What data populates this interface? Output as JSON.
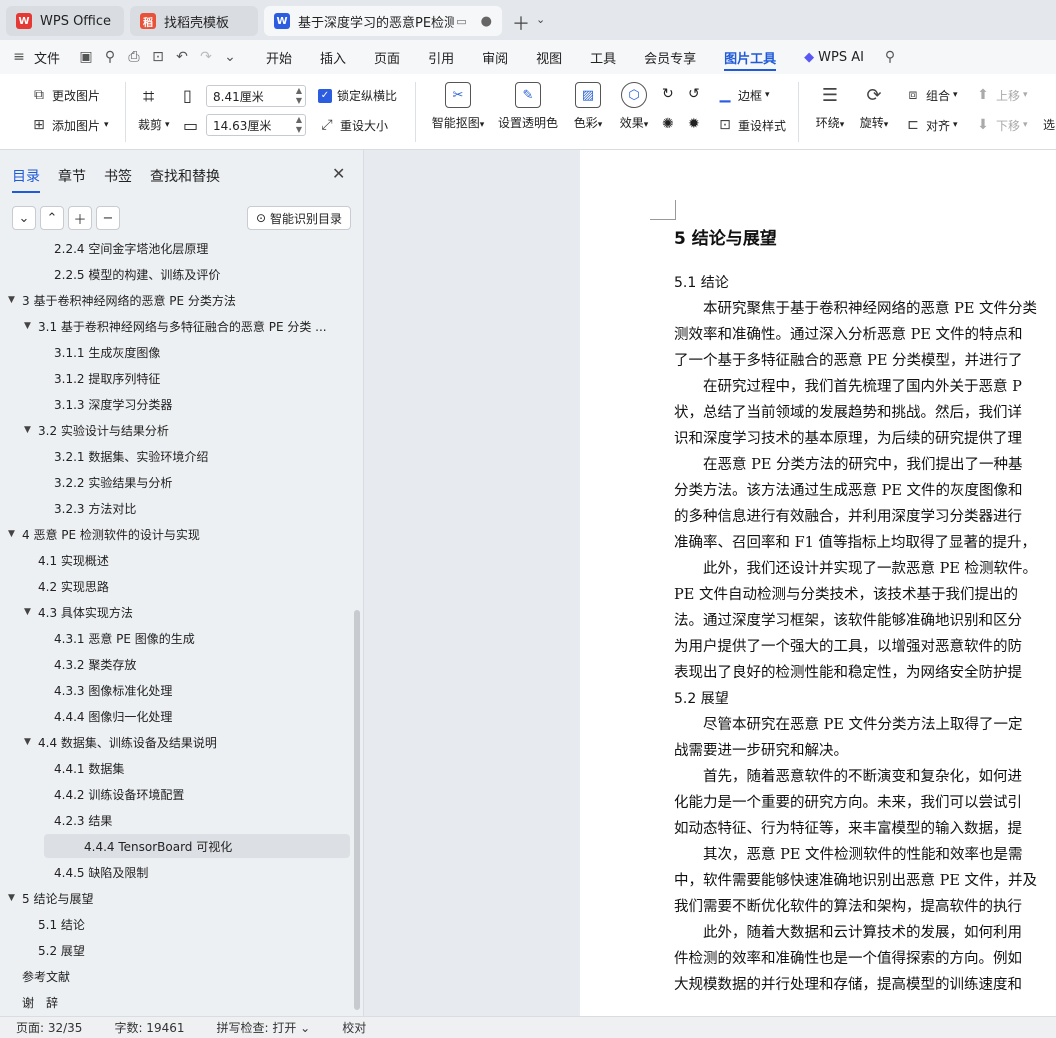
{
  "tabs": [
    {
      "label": "WPS Office",
      "logo": "W"
    },
    {
      "label": "找稻壳模板",
      "logo": "稻"
    },
    {
      "label": "基于深度学习的恶意PE检测软",
      "logo": "W",
      "active": true
    }
  ],
  "menu": {
    "file": "文件",
    "items": [
      "开始",
      "插入",
      "页面",
      "引用",
      "审阅",
      "视图",
      "工具",
      "会员专享"
    ],
    "active": "图片工具",
    "ai": "WPS AI"
  },
  "ribbon": {
    "change_pic": "更改图片",
    "add_pic": "添加图片",
    "crop": "裁剪",
    "width": "8.41厘米",
    "height": "14.63厘米",
    "lock_ratio": "锁定纵横比",
    "resize": "重设大小",
    "smart_cutout": "智能抠图",
    "set_transparent": "设置透明色",
    "color": "色彩",
    "effect": "效果",
    "border": "边框",
    "reset_style": "重设样式",
    "wrap": "环绕",
    "rotate": "旋转",
    "group": "组合",
    "align": "对齐",
    "up": "上移",
    "down": "下移",
    "select": "选"
  },
  "panel": {
    "tabs": [
      "目录",
      "章节",
      "书签",
      "查找和替换"
    ],
    "smart_toc": "智能识别目录",
    "toc": [
      {
        "text": "2.2.4 空间金字塔池化层原理",
        "level": 3,
        "exp": ""
      },
      {
        "text": "2.2.5 模型的构建、训练及评价",
        "level": 3,
        "exp": ""
      },
      {
        "text": "3 基于卷积神经网络的恶意 PE 分类方法",
        "level": 1,
        "exp": "▼"
      },
      {
        "text": "3.1 基于卷积神经网络与多特征融合的恶意 PE 分类 ...",
        "level": 2,
        "exp": "▼"
      },
      {
        "text": "3.1.1 生成灰度图像",
        "level": 3,
        "exp": ""
      },
      {
        "text": "3.1.2 提取序列特征",
        "level": 3,
        "exp": ""
      },
      {
        "text": "3.1.3 深度学习分类器",
        "level": 3,
        "exp": ""
      },
      {
        "text": "3.2 实验设计与结果分析",
        "level": 2,
        "exp": "▼"
      },
      {
        "text": "3.2.1 数据集、实验环境介绍",
        "level": 3,
        "exp": ""
      },
      {
        "text": "3.2.2 实验结果与分析",
        "level": 3,
        "exp": ""
      },
      {
        "text": "3.2.3 方法对比",
        "level": 3,
        "exp": ""
      },
      {
        "text": "4 恶意 PE 检测软件的设计与实现",
        "level": 1,
        "exp": "▼"
      },
      {
        "text": "4.1 实现概述",
        "level": 2,
        "exp": ""
      },
      {
        "text": "4.2 实现思路",
        "level": 2,
        "exp": ""
      },
      {
        "text": "4.3 具体实现方法",
        "level": 2,
        "exp": "▼"
      },
      {
        "text": "4.3.1 恶意 PE 图像的生成",
        "level": 3,
        "exp": ""
      },
      {
        "text": "4.3.2 聚类存放",
        "level": 3,
        "exp": ""
      },
      {
        "text": "4.3.3 图像标准化处理",
        "level": 3,
        "exp": ""
      },
      {
        "text": "4.4.4 图像归一化处理",
        "level": 3,
        "exp": ""
      },
      {
        "text": "4.4 数据集、训练设备及结果说明",
        "level": 2,
        "exp": "▼"
      },
      {
        "text": "4.4.1 数据集",
        "level": 3,
        "exp": ""
      },
      {
        "text": "4.4.2 训练设备环境配置",
        "level": 3,
        "exp": ""
      },
      {
        "text": "4.2.3 结果",
        "level": 3,
        "exp": ""
      },
      {
        "text": "4.4.4 TensorBoard 可视化",
        "level": 3,
        "exp": "",
        "sel": true
      },
      {
        "text": "4.4.5 缺陷及限制",
        "level": 3,
        "exp": ""
      },
      {
        "text": "5 结论与展望",
        "level": 1,
        "exp": "▼"
      },
      {
        "text": "5.1 结论",
        "level": 2,
        "exp": ""
      },
      {
        "text": "5.2 展望",
        "level": 2,
        "exp": ""
      },
      {
        "text": "参考文献",
        "level": 1,
        "exp": ""
      },
      {
        "text": "谢　辞",
        "level": 1,
        "exp": ""
      }
    ]
  },
  "doc": {
    "lines": [
      {
        "t": "5 结论与展望",
        "cls": "h1"
      },
      {
        "t": "5.1 结论",
        "cls": "h2"
      },
      {
        "t": "　　本研究聚焦于基于卷积神经网络的恶意 PE 文件分类",
        "cls": ""
      },
      {
        "t": "测效率和准确性。通过深入分析恶意 PE 文件的特点和",
        "cls": ""
      },
      {
        "t": "了一个基于多特征融合的恶意 PE 分类模型，并进行了",
        "cls": ""
      },
      {
        "t": "　　在研究过程中，我们首先梳理了国内外关于恶意 P",
        "cls": ""
      },
      {
        "t": "状，总结了当前领域的发展趋势和挑战。然后，我们详",
        "cls": ""
      },
      {
        "t": "识和深度学习技术的基本原理，为后续的研究提供了理",
        "cls": ""
      },
      {
        "t": "　　在恶意 PE 分类方法的研究中，我们提出了一种基",
        "cls": ""
      },
      {
        "t": "分类方法。该方法通过生成恶意 PE 文件的灰度图像和",
        "cls": ""
      },
      {
        "t": "的多种信息进行有效融合，并利用深度学习分类器进行",
        "cls": ""
      },
      {
        "t": "准确率、召回率和 F1 值等指标上均取得了显著的提升，",
        "cls": ""
      },
      {
        "t": "　　此外，我们还设计并实现了一款恶意 PE 检测软件。",
        "cls": ""
      },
      {
        "t": "PE 文件自动检测与分类技术，该技术基于我们提出的",
        "cls": ""
      },
      {
        "t": "法。通过深度学习框架，该软件能够准确地识别和区分",
        "cls": ""
      },
      {
        "t": "为用户提供了一个强大的工具，以增强对恶意软件的防",
        "cls": ""
      },
      {
        "t": "表现出了良好的检测性能和稳定性，为网络安全防护提",
        "cls": ""
      },
      {
        "t": "5.2 展望",
        "cls": "h2"
      },
      {
        "t": "　　尽管本研究在恶意 PE 文件分类方法上取得了一定",
        "cls": ""
      },
      {
        "t": "战需要进一步研究和解决。",
        "cls": ""
      },
      {
        "t": "　　首先，随着恶意软件的不断演变和复杂化，如何进",
        "cls": ""
      },
      {
        "t": "化能力是一个重要的研究方向。未来，我们可以尝试引",
        "cls": ""
      },
      {
        "t": "如动态特征、行为特征等，来丰富模型的输入数据，提",
        "cls": ""
      },
      {
        "t": "　　其次，恶意 PE 文件检测软件的性能和效率也是需",
        "cls": ""
      },
      {
        "t": "中，软件需要能够快速准确地识别出恶意 PE 文件，并及",
        "cls": ""
      },
      {
        "t": "我们需要不断优化软件的算法和架构，提高软件的执行",
        "cls": ""
      },
      {
        "t": "　　此外，随着大数据和云计算技术的发展，如何利用",
        "cls": ""
      },
      {
        "t": "件检测的效率和准确性也是一个值得探索的方向。例如",
        "cls": ""
      },
      {
        "t": "大规模数据的并行处理和存储，提高模型的训练速度和",
        "cls": ""
      }
    ]
  },
  "status": {
    "page": "页面: 32/35",
    "words": "字数: 19461",
    "spell": "拼写检查: 打开 ⌄",
    "proof": "校对"
  }
}
